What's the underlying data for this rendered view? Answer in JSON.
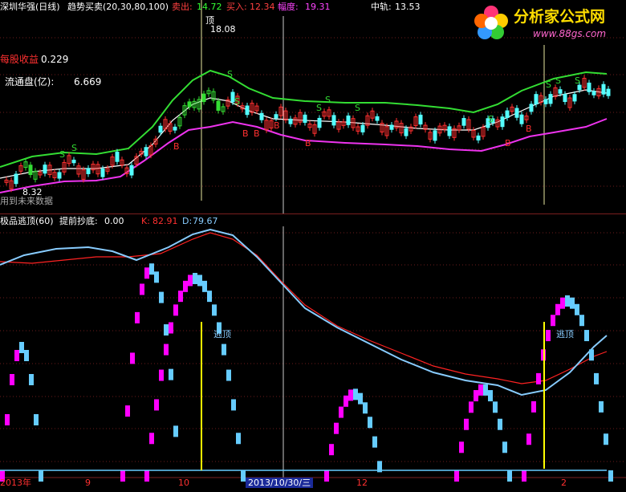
{
  "top_legend": {
    "stock": "深圳华强(日线)",
    "indicator": "趋势买卖(20,30,80,100)",
    "sell_label": "卖出:",
    "sell_value": "14.72",
    "buy_label": "买入:",
    "buy_value": "12.34",
    "amp_label": "幅度:",
    "amp_value": "19.31",
    "mid_label": "中轨:",
    "mid_value": "13.53"
  },
  "info": {
    "eps_label": "每股收益",
    "eps_value": "0.229",
    "float_label": "流通盘(亿):",
    "float_value": "6.669",
    "data_note": "用到未来数据",
    "low_price": "8.32",
    "high_price": "18.08",
    "high_tag": "顶"
  },
  "signals": {
    "s": "S",
    "b": "B",
    "top_escape": "逃顶"
  },
  "bottom_legend": {
    "name": "极品逃顶(60)",
    "early_label": "提前抄底:",
    "early_value": "0.00",
    "k_label": "K:",
    "k_value": "82.91",
    "d_label": "D:",
    "d_value": "79.67"
  },
  "x_axis": {
    "year": "2013年",
    "m9": "9",
    "m10": "10",
    "cursor_date": "2013/10/30/三",
    "m12": "12",
    "m2": "2"
  },
  "watermark": {
    "title": "分析家公式网",
    "url": "www.88gs.com"
  },
  "colors": {
    "up": "#ff3030",
    "down": "#54ffff",
    "upper_band": "#33dd33",
    "mid_band": "#ffffff",
    "lower_band": "#ee33ee",
    "k_line": "#ff2222",
    "d_line": "#88ccff",
    "magenta_bar": "#ff00ff",
    "cyan_bar": "#66ccff"
  }
}
